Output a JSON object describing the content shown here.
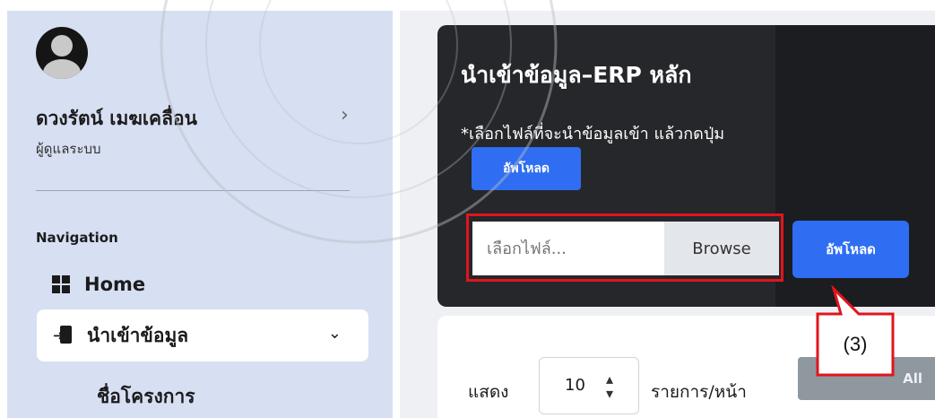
{
  "sidebar": {
    "user": {
      "name": "ดวงรัตน์ เมฆเคลื่อน",
      "role": "ผู้ดูแลระบบ",
      "expand_icon": "chevron-right-icon"
    },
    "nav_caption": "Navigation",
    "items": [
      {
        "label": "Home",
        "icon": "grid-icon"
      },
      {
        "label": "นำเข้าข้อมูล",
        "icon": "file-import-icon",
        "expanded": true
      },
      {
        "label": "ชื่อโครงการ"
      }
    ]
  },
  "import_card": {
    "title": "นำเข้าข้อมูล–ERP หลัก",
    "instruction": "*เลือกไฟล์ที่จะนำข้อมูลเข้า แล้วกดปุ่ม",
    "inline_button_label": "อัพโหลด",
    "file_input_placeholder": "เลือกไฟล์...",
    "browse_label": "Browse",
    "upload_label": "อัพโหลด"
  },
  "table_controls": {
    "show_label": "แสดง",
    "page_size": "10",
    "per_page_label": "รายการ/หน้า",
    "export_label": "All"
  },
  "annotation": {
    "callout_text": "(3)"
  },
  "colors": {
    "accent_blue": "#2f6ef2",
    "highlight_red": "#e0151c",
    "sidebar_bg": "#d7dff3",
    "card_dark": "#26272b"
  }
}
